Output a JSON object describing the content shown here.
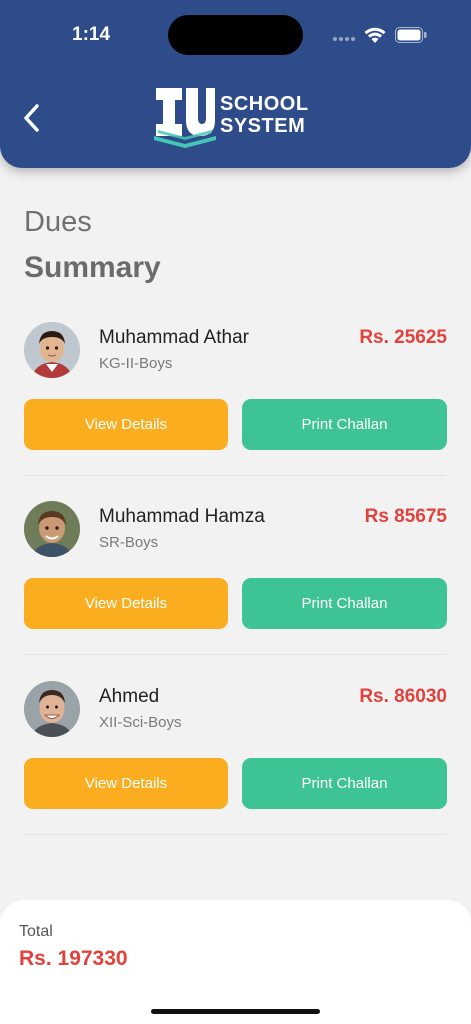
{
  "status_bar": {
    "time": "1:14"
  },
  "header": {
    "logo_line1": "SCHOOL",
    "logo_line2": "SYSTEM",
    "brand_color": "#2e4b8a"
  },
  "page": {
    "title_line1": "Dues",
    "title_line2": "Summary"
  },
  "students": [
    {
      "name": "Muhammad Athar",
      "class": "KG-II-Boys",
      "amount": "Rs. 25625",
      "view_label": "View Details",
      "print_label": "Print Challan"
    },
    {
      "name": "Muhammad Hamza",
      "class": "SR-Boys",
      "amount": "Rs 85675",
      "view_label": "View Details",
      "print_label": "Print Challan"
    },
    {
      "name": "Ahmed",
      "class": "XII-Sci-Boys",
      "amount": "Rs. 86030",
      "view_label": "View Details",
      "print_label": "Print Challan"
    }
  ],
  "total": {
    "label": "Total",
    "value": "Rs. 197330"
  },
  "colors": {
    "view_button": "#f9ad1f",
    "print_button": "#3ec494",
    "amount": "#e3423c"
  }
}
